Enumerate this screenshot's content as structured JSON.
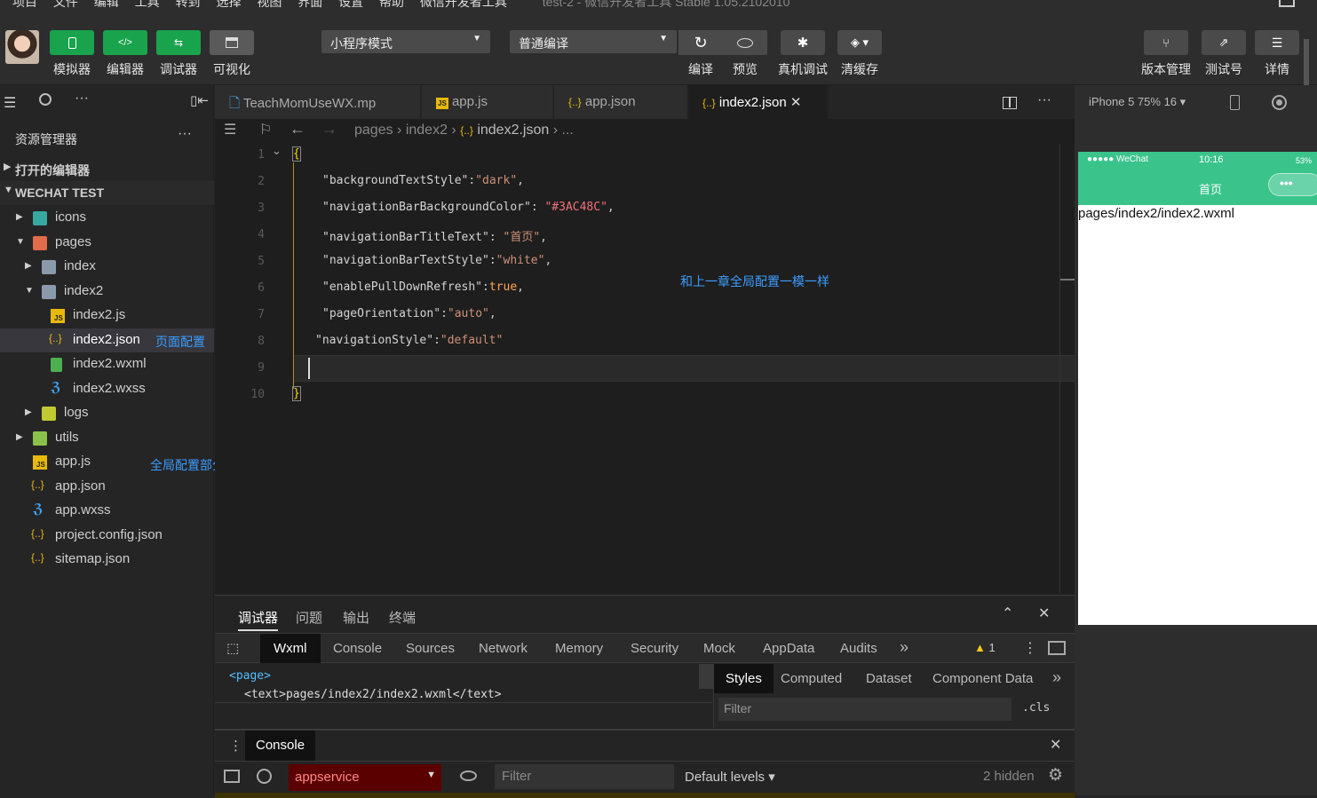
{
  "menubar": {
    "items": [
      "项目",
      "文件",
      "编辑",
      "工具",
      "转到",
      "选择",
      "视图",
      "界面",
      "设置",
      "帮助",
      "微信开发者工具"
    ],
    "title": "test-2 - 微信开发者工具 Stable 1.05.2102010"
  },
  "toolbar": {
    "mode_buttons": [
      {
        "label": "模拟器",
        "icon": "phone-icon"
      },
      {
        "label": "编辑器",
        "icon": "code-icon"
      },
      {
        "label": "调试器",
        "icon": "debug-icon"
      },
      {
        "label": "可视化",
        "icon": "layout-icon"
      }
    ],
    "mode_select": "小程序模式",
    "compile_select": "普通编译",
    "actions": [
      {
        "label": "编译",
        "icon": "refresh-icon"
      },
      {
        "label": "预览",
        "icon": "eye-icon"
      },
      {
        "label": "真机调试",
        "icon": "bug-icon"
      },
      {
        "label": "清缓存",
        "icon": "layers-icon"
      }
    ],
    "right_actions": [
      {
        "label": "版本管理",
        "icon": "branch-icon"
      },
      {
        "label": "测试号",
        "icon": "external-icon"
      },
      {
        "label": "详情",
        "icon": "menu-icon"
      }
    ]
  },
  "sidebar": {
    "title": "资源管理器",
    "more": "···",
    "sections": {
      "open_editors": "打开的编辑器",
      "project": "WECHAT TEST"
    },
    "tree": [
      {
        "label": "icons",
        "type": "folder"
      },
      {
        "label": "pages",
        "type": "folder"
      },
      {
        "label": "index",
        "type": "folder"
      },
      {
        "label": "index2",
        "type": "folder"
      },
      {
        "label": "index2.js",
        "type": "js"
      },
      {
        "label": "index2.json",
        "type": "json"
      },
      {
        "label": "index2.wxml",
        "type": "wxml"
      },
      {
        "label": "index2.wxss",
        "type": "wxss"
      },
      {
        "label": "logs",
        "type": "folder"
      },
      {
        "label": "utils",
        "type": "folder"
      },
      {
        "label": "app.js",
        "type": "js"
      },
      {
        "label": "app.json",
        "type": "json"
      },
      {
        "label": "app.wxss",
        "type": "wxss"
      },
      {
        "label": "project.config.json",
        "type": "json"
      },
      {
        "label": "sitemap.json",
        "type": "json"
      }
    ],
    "notes": {
      "page_config": "页面配置",
      "global_config": "全局配置部分"
    }
  },
  "tabs": [
    {
      "label": "TeachMomUseWX.mp"
    },
    {
      "label": "app.js"
    },
    {
      "label": "app.json"
    },
    {
      "label": "index2.json",
      "close": "✕"
    }
  ],
  "breadcrumb": [
    "pages",
    "index2",
    "index2.json",
    "..."
  ],
  "code": {
    "lines": [
      {
        "n": "1",
        "text": "{"
      },
      {
        "n": "2",
        "k": "\"backgroundTextStyle\"",
        "sep": ":",
        "v": "\"dark\"",
        "end": ","
      },
      {
        "n": "3",
        "k": "\"navigationBarBackgroundColor\"",
        "sep": ": ",
        "v": "\"#3AC48C\"",
        "end": ","
      },
      {
        "n": "4",
        "k": "\"navigationBarTitleText\"",
        "sep": ": ",
        "v": "\"首页\"",
        "end": ","
      },
      {
        "n": "5",
        "k": "\"navigationBarTextStyle\"",
        "sep": ":",
        "v": "\"white\"",
        "end": ","
      },
      {
        "n": "6",
        "k": "\"enablePullDownRefresh\"",
        "sep": ":",
        "v": "true",
        "end": ","
      },
      {
        "n": "7",
        "k": "\"pageOrientation\"",
        "sep": ":",
        "v": "\"auto\"",
        "end": ","
      },
      {
        "n": "8",
        "k": "\"navigationStyle\"",
        "sep": ":",
        "v": "\"default\"",
        "end": ""
      },
      {
        "n": "9",
        "text": ""
      },
      {
        "n": "10",
        "text": "}"
      }
    ],
    "annotation": "和上一章全局配置一模一样"
  },
  "devtools": {
    "top_tabs": [
      "调试器",
      "问题",
      "输出",
      "终端"
    ],
    "panel_tabs": [
      "Wxml",
      "Console",
      "Sources",
      "Network",
      "Memory",
      "Security",
      "Mock",
      "AppData",
      "Audits"
    ],
    "more": "»",
    "warning_count": "1",
    "wxml": [
      "<page>",
      "<text>pages/index2/index2.wxml</text>"
    ],
    "style_tabs": [
      "Styles",
      "Computed",
      "Dataset",
      "Component Data"
    ],
    "filter_placeholder": "Filter",
    "cls": ".cls",
    "console_title": "Console",
    "console_context": "appservice",
    "console_filter": "Filter",
    "levels": "Default levels ▾",
    "hidden": "2 hidden"
  },
  "simulator": {
    "device": "iPhone 5 75% 16 ▾",
    "status": {
      "carrier": "●●●●● WeChat",
      "time": "10:16",
      "battery": "53%"
    },
    "nav_title": "首页",
    "nav_color": "#3AC48C",
    "content": "pages/index2/index2.wxml"
  }
}
